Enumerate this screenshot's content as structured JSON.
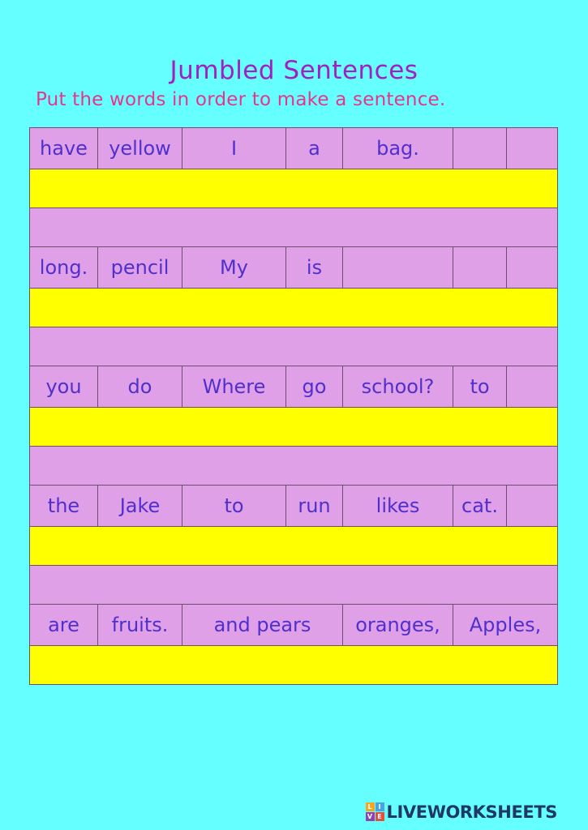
{
  "worksheet": {
    "title": "Jumbled Sentences",
    "instruction": "Put the words in order to make a sentence."
  },
  "colors": {
    "background": "#66FFFF",
    "title": "#A020C0",
    "instruction": "#E8358C",
    "cell_fill": "#E0A0E8",
    "answer_fill": "#FFFF00",
    "cell_text": "#5030CC",
    "cell_border": "#6B4F6B",
    "logo_text": "#1F3864"
  },
  "exercises": [
    {
      "id": 1,
      "words": [
        "have",
        "yellow",
        "I",
        "a",
        "bag.",
        "",
        ""
      ],
      "answer": ""
    },
    {
      "id": 2,
      "words": [
        "long.",
        "pencil",
        "My",
        "is",
        "",
        "",
        ""
      ],
      "answer": ""
    },
    {
      "id": 3,
      "words": [
        "you",
        "do",
        "Where",
        "go",
        "school?",
        "to",
        ""
      ],
      "answer": ""
    },
    {
      "id": 4,
      "words": [
        "the",
        "Jake",
        "to",
        "run",
        "likes",
        "cat.",
        ""
      ],
      "answer": ""
    },
    {
      "id": 5,
      "words": [
        "are",
        "fruits.",
        "and pears",
        "oranges,",
        "Apples,"
      ],
      "answer": ""
    }
  ],
  "footer": {
    "logo_letters": [
      "L",
      "I",
      "V",
      "E"
    ],
    "logo_text": "LIVEWORKSHEETS"
  }
}
